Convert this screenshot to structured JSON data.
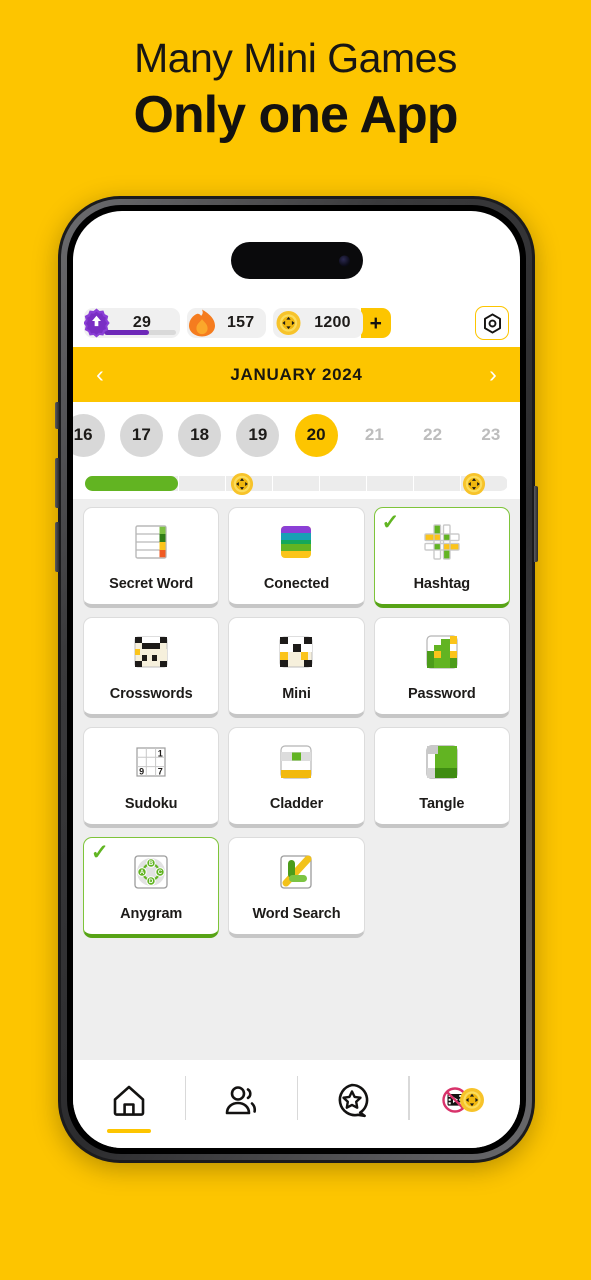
{
  "headline": {
    "line1": "Many Mini Games",
    "line2": "Only one App"
  },
  "colors": {
    "brand_yellow": "#FDC500",
    "green": "#62b422",
    "purple": "#6d28b8",
    "orange": "#f57c1f",
    "grey_bg": "#eeeeee"
  },
  "statusbar": {
    "level": {
      "icon": "level-star-icon",
      "value": "29",
      "progress_percent": 62
    },
    "streak": {
      "icon": "fire-icon",
      "value": "157"
    },
    "coins": {
      "icon": "coin-icon",
      "value": "1200",
      "add_label": "+"
    },
    "settings": {
      "icon": "settings-gear-icon"
    }
  },
  "calendar": {
    "prev_label": "‹",
    "next_label": "›",
    "month_title": "JANUARY 2024",
    "days": [
      {
        "num": "16",
        "state": "past"
      },
      {
        "num": "17",
        "state": "past"
      },
      {
        "num": "18",
        "state": "past"
      },
      {
        "num": "19",
        "state": "past"
      },
      {
        "num": "20",
        "state": "today"
      },
      {
        "num": "21",
        "state": "future"
      },
      {
        "num": "22",
        "state": "future"
      },
      {
        "num": "23",
        "state": "future"
      }
    ]
  },
  "reward_progress": {
    "segments": 9,
    "fill_percent": 22,
    "markers": [
      {
        "icon": "coin-icon",
        "position_percent": 37
      },
      {
        "icon": "coin-icon",
        "position_percent": 92
      }
    ]
  },
  "games": [
    {
      "label": "Secret Word",
      "icon": "secret-word-icon",
      "completed": false
    },
    {
      "label": "Conected",
      "icon": "conected-icon",
      "completed": false
    },
    {
      "label": "Hashtag",
      "icon": "hashtag-icon",
      "completed": true
    },
    {
      "label": "Crosswords",
      "icon": "crosswords-icon",
      "completed": false
    },
    {
      "label": "Mini",
      "icon": "mini-crossword-icon",
      "completed": false
    },
    {
      "label": "Password",
      "icon": "password-icon",
      "completed": false
    },
    {
      "label": "Sudoku",
      "icon": "sudoku-icon",
      "completed": false
    },
    {
      "label": "Cladder",
      "icon": "cladder-icon",
      "completed": false
    },
    {
      "label": "Tangle",
      "icon": "tangle-icon",
      "completed": false
    },
    {
      "label": "Anygram",
      "icon": "anygram-icon",
      "completed": true
    },
    {
      "label": "Word Search",
      "icon": "word-search-icon",
      "completed": false
    }
  ],
  "sudoku_digits": {
    "top_right": "1",
    "bottom_left": "9",
    "bottom_right": "7"
  },
  "anygram_letters": {
    "top": "B",
    "left": "A",
    "right": "C",
    "bottom": "D"
  },
  "check_mark": "✓",
  "bottom_nav": [
    {
      "icon": "home-icon",
      "active": true
    },
    {
      "icon": "friends-icon",
      "active": false
    },
    {
      "icon": "star-badge-icon",
      "active": false
    },
    {
      "icon": "remove-ads-coin-icon",
      "active": false
    }
  ]
}
